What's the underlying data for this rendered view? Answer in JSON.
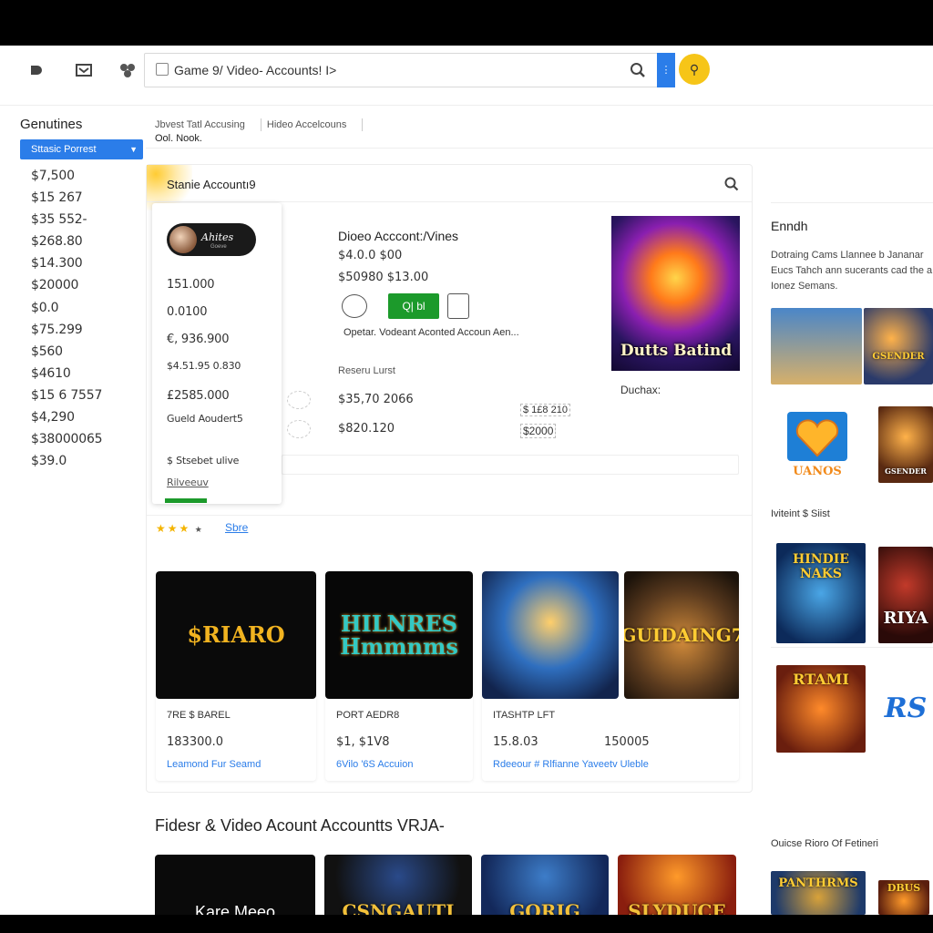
{
  "toolbar": {
    "search_value": "Game 9/ Video- Accounts! I>",
    "icons": [
      "sidebar-toggle-icon",
      "mail-icon",
      "apps-icon",
      "search-icon",
      "menu-icon",
      "key-icon"
    ]
  },
  "sidebar": {
    "title": "Genutines",
    "selected": "Sttasic Porrest",
    "prices": [
      "$7,500",
      "$15 267",
      "$35 552-",
      "$268.80",
      "$14.300",
      "$20000",
      "$0.0",
      "$75.299",
      "$560",
      "$4610",
      "$15 6 7557",
      "$4,290",
      "$38000065",
      "$39.0"
    ]
  },
  "breadcrumb": {
    "items": [
      "Jbvest Tatl Accusing",
      "Hideo Accelcouns"
    ],
    "sub": "Ool. Nook."
  },
  "panel": {
    "title": "Stanie Accountı9",
    "card": {
      "logo_text": "Ahites",
      "logo_sub": "Goeve",
      "rows": [
        "151.000",
        "0.0100",
        "€, 936.900",
        "$4.51.95 0.830",
        "£2585.000"
      ],
      "label1": "Gueld Aoudert5",
      "label2": "$ Stsebet ulive",
      "label3": "Rilveeuv"
    },
    "detail": {
      "title": "Dioeo Acccont:/Vines",
      "price1": "$4.0.0 $00",
      "price2": "$50980 $13.00",
      "green_btn": "Q| bl",
      "desc": "Opetar. Vodeant Aconted Accoun Aen...",
      "list_label": "Reseru Lurst",
      "val1": "$35,70 2066",
      "val2": "$820.120",
      "val3": "$ 1£8 210",
      "val4": "$2000",
      "side_label": "Duchax:",
      "hero_caption": "Dutts Batind"
    },
    "stars_link": "Sbre",
    "games": [
      {
        "thumb": "$RIARO",
        "name": "7RE $ BAREL",
        "price": "183300.0",
        "price2": "",
        "link": "Leamond Fur Seamd",
        "color": "#f1b320"
      },
      {
        "thumb": "HILNRES Hmmnms",
        "name": "PORT AEDR8",
        "price": "$1, $1V8",
        "price2": "",
        "link": "6Vilo '6S Accuion",
        "color": "#33c9c4"
      },
      {
        "thumb": "",
        "name": "ITASHTP LFT",
        "price": "15.8.03",
        "price2": "150005",
        "link": "Rdeeour # Rlfianne Yaveetv Uleble",
        "color": "#ffd24a"
      },
      {
        "thumb": "GUIDAING7",
        "name": "",
        "price": "",
        "price2": "",
        "link": "",
        "color": "#ffcc33"
      }
    ]
  },
  "section2": {
    "title": "Fidesr & Video Acount Accountts VRJA-",
    "cards": [
      "Kare Meeo",
      "CSNGAUTI",
      "GORIG",
      "SLYDUCE"
    ]
  },
  "rail": {
    "title": "Enndh",
    "desc_lines": [
      "Dotraing Cams Llannee b Jananar",
      "Eucs Tahch ann sucerants cad the a",
      "Ionez Semans."
    ],
    "section1": "Iviteint $ Siist",
    "section2": "Ouicse Rioro Of Fetineri",
    "tiles": [
      "",
      "GSENDER",
      "UANOS",
      "GSENDER",
      "HINDIE NAKS",
      "RIYA",
      "RTAMI",
      "RS",
      "PANTHRMS",
      "DBUS"
    ]
  }
}
